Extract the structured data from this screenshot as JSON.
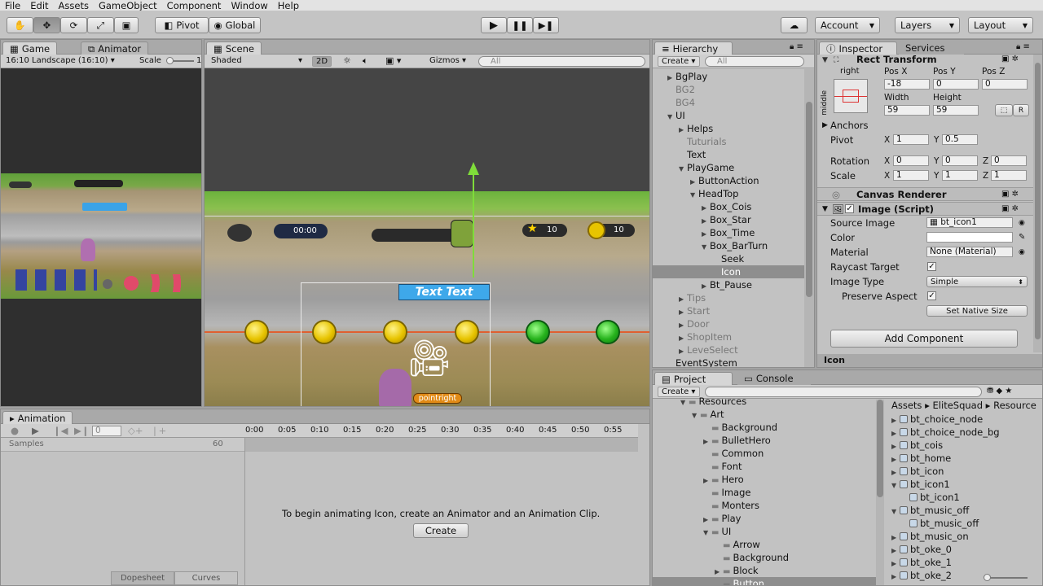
{
  "menu": [
    "File",
    "Edit",
    "Assets",
    "GameObject",
    "Component",
    "Window",
    "Help"
  ],
  "toolbar": {
    "pivot": "Pivot",
    "global": "Global",
    "account": "Account",
    "layers": "Layers",
    "layout": "Layout"
  },
  "game": {
    "tab_game": "Game",
    "tab_animator": "Animator",
    "aspect": "16:10 Landscape (16:10)",
    "scale_label": "Scale",
    "scale_value": "1"
  },
  "scene": {
    "tab": "Scene",
    "shading": "Shaded",
    "mode2d": "2D",
    "gizmos": "Gizmos",
    "search": "All",
    "banner": "Text Text",
    "pointright": "pointright",
    "timer": "00:00",
    "count1": "10",
    "count2": "10"
  },
  "animation": {
    "tab": "Animation",
    "frame": "0",
    "samples_label": "Samples",
    "samples_value": "60",
    "ticks": [
      "0:00",
      "0:05",
      "0:10",
      "0:15",
      "0:20",
      "0:25",
      "0:30",
      "0:35",
      "0:40",
      "0:45",
      "0:50",
      "0:55"
    ],
    "message": "To begin animating Icon, create an Animator and an Animation Clip.",
    "create": "Create",
    "dopesheet": "Dopesheet",
    "curves": "Curves"
  },
  "hierarchy": {
    "tab": "Hierarchy",
    "create": "Create",
    "search": "All",
    "items": [
      {
        "label": "BgPlay",
        "indent": 1,
        "arrow": "right",
        "dim": false
      },
      {
        "label": "BG2",
        "indent": 1,
        "arrow": "",
        "dim": true
      },
      {
        "label": "BG4",
        "indent": 1,
        "arrow": "",
        "dim": true
      },
      {
        "label": "UI",
        "indent": 1,
        "arrow": "down",
        "dim": false
      },
      {
        "label": "Helps",
        "indent": 2,
        "arrow": "right",
        "dim": false
      },
      {
        "label": "Tuturials",
        "indent": 2,
        "arrow": "",
        "dim": true
      },
      {
        "label": "Text",
        "indent": 2,
        "arrow": "",
        "dim": false
      },
      {
        "label": "PlayGame",
        "indent": 2,
        "arrow": "down",
        "dim": false
      },
      {
        "label": "ButtonAction",
        "indent": 3,
        "arrow": "right",
        "dim": false
      },
      {
        "label": "HeadTop",
        "indent": 3,
        "arrow": "down",
        "dim": false
      },
      {
        "label": "Box_Cois",
        "indent": 4,
        "arrow": "right",
        "dim": false
      },
      {
        "label": "Box_Star",
        "indent": 4,
        "arrow": "right",
        "dim": false
      },
      {
        "label": "Box_Time",
        "indent": 4,
        "arrow": "right",
        "dim": false
      },
      {
        "label": "Box_BarTurn",
        "indent": 4,
        "arrow": "down",
        "dim": false
      },
      {
        "label": "Seek",
        "indent": 5,
        "arrow": "",
        "dim": false
      },
      {
        "label": "Icon",
        "indent": 5,
        "arrow": "",
        "dim": false,
        "selected": true
      },
      {
        "label": "Bt_Pause",
        "indent": 4,
        "arrow": "right",
        "dim": false
      },
      {
        "label": "Tips",
        "indent": 2,
        "arrow": "right",
        "dim": true
      },
      {
        "label": "Start",
        "indent": 2,
        "arrow": "right",
        "dim": true
      },
      {
        "label": "Door",
        "indent": 2,
        "arrow": "right",
        "dim": true
      },
      {
        "label": "ShopItem",
        "indent": 2,
        "arrow": "right",
        "dim": true
      },
      {
        "label": "LeveSelect",
        "indent": 2,
        "arrow": "right",
        "dim": true
      },
      {
        "label": "EventSystem",
        "indent": 1,
        "arrow": "",
        "dim": false
      }
    ]
  },
  "inspector": {
    "tab": "Inspector",
    "services": "Services",
    "rect": {
      "title": "Rect Transform",
      "anchor_h": "right",
      "anchor_v": "middle",
      "posx_l": "Pos X",
      "posy_l": "Pos Y",
      "posz_l": "Pos Z",
      "posx": "-18",
      "posy": "0",
      "posz": "0",
      "width_l": "Width",
      "height_l": "Height",
      "width": "59",
      "height": "59",
      "r": "R"
    },
    "anchors": "Anchors",
    "pivot_l": "Pivot",
    "pivot_x": "1",
    "pivot_y": "0.5",
    "rotation_l": "Rotation",
    "rot_x": "0",
    "rot_y": "0",
    "rot_z": "0",
    "scale_l": "Scale",
    "sc_x": "1",
    "sc_y": "1",
    "sc_z": "1",
    "x": "X",
    "y": "Y",
    "z": "Z",
    "canvas_renderer": "Canvas Renderer",
    "image": {
      "title": "Image (Script)",
      "source_l": "Source Image",
      "source": "bt_icon1",
      "color_l": "Color",
      "material_l": "Material",
      "material": "None (Material)",
      "raycast_l": "Raycast Target",
      "type_l": "Image Type",
      "type": "Simple",
      "preserve_l": "Preserve Aspect",
      "native": "Set Native Size"
    },
    "add_component": "Add Component",
    "footer": "Icon"
  },
  "project": {
    "tab_project": "Project",
    "tab_console": "Console",
    "create": "Create",
    "tree": [
      {
        "label": "Resources",
        "indent": 1,
        "arrow": "down"
      },
      {
        "label": "Art",
        "indent": 2,
        "arrow": "down"
      },
      {
        "label": "Background",
        "indent": 3,
        "arrow": ""
      },
      {
        "label": "BulletHero",
        "indent": 3,
        "arrow": "right"
      },
      {
        "label": "Common",
        "indent": 3,
        "arrow": ""
      },
      {
        "label": "Font",
        "indent": 3,
        "arrow": ""
      },
      {
        "label": "Hero",
        "indent": 3,
        "arrow": "right"
      },
      {
        "label": "Image",
        "indent": 3,
        "arrow": ""
      },
      {
        "label": "Monters",
        "indent": 3,
        "arrow": ""
      },
      {
        "label": "Play",
        "indent": 3,
        "arrow": "right"
      },
      {
        "label": "UI",
        "indent": 3,
        "arrow": "down"
      },
      {
        "label": "Arrow",
        "indent": 4,
        "arrow": ""
      },
      {
        "label": "Background",
        "indent": 4,
        "arrow": ""
      },
      {
        "label": "Block",
        "indent": 4,
        "arrow": "right"
      },
      {
        "label": "Button",
        "indent": 4,
        "arrow": "",
        "selected": true
      }
    ],
    "breadcrumb": [
      "Assets",
      "EliteSquad",
      "Resource"
    ],
    "assets": [
      {
        "label": "bt_choice_node",
        "indent": 0,
        "arrow": "right"
      },
      {
        "label": "bt_choice_node_bg",
        "indent": 0,
        "arrow": "right"
      },
      {
        "label": "bt_cois",
        "indent": 0,
        "arrow": "right"
      },
      {
        "label": "bt_home",
        "indent": 0,
        "arrow": "right"
      },
      {
        "label": "bt_icon",
        "indent": 0,
        "arrow": "right"
      },
      {
        "label": "bt_icon1",
        "indent": 0,
        "arrow": "down"
      },
      {
        "label": "bt_icon1",
        "indent": 1,
        "arrow": ""
      },
      {
        "label": "bt_music_off",
        "indent": 0,
        "arrow": "down"
      },
      {
        "label": "bt_music_off",
        "indent": 1,
        "arrow": ""
      },
      {
        "label": "bt_music_on",
        "indent": 0,
        "arrow": "right"
      },
      {
        "label": "bt_oke_0",
        "indent": 0,
        "arrow": "right"
      },
      {
        "label": "bt_oke_1",
        "indent": 0,
        "arrow": "right"
      },
      {
        "label": "bt_oke_2",
        "indent": 0,
        "arrow": "right"
      }
    ]
  }
}
